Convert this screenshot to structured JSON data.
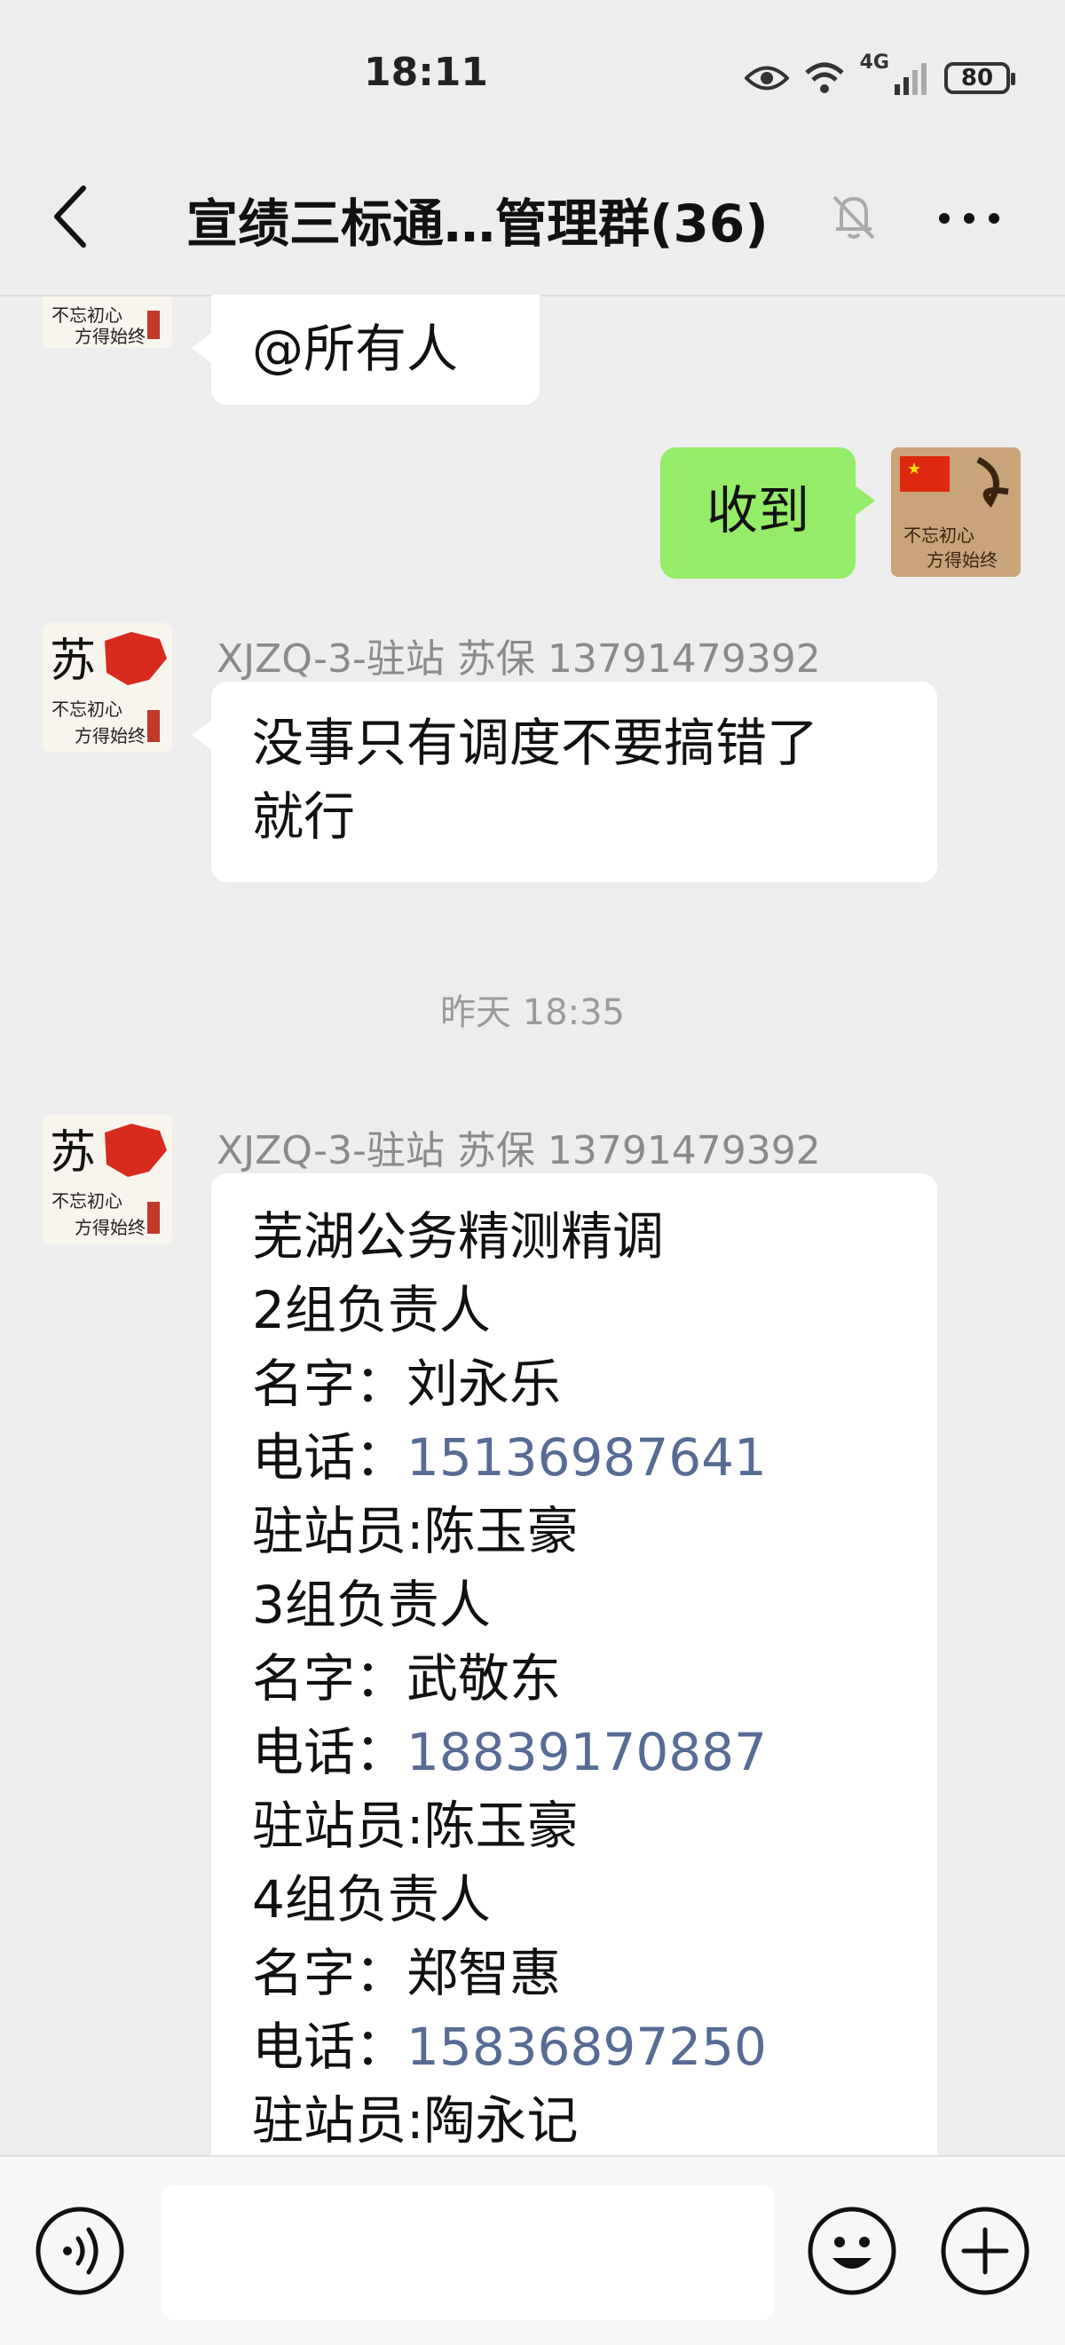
{
  "status_bar": {
    "time": "18:11",
    "battery": "80",
    "network": "4G"
  },
  "header": {
    "title": "宣绩三标通…管理群(36)"
  },
  "messages": {
    "m1": {
      "text": "@所有人"
    },
    "m2": {
      "text": "收到"
    },
    "m3": {
      "sender": "XJZQ-3-驻站  苏保 13791479392",
      "lines": [
        "没事只有调度不要搞错了",
        "就行"
      ]
    },
    "timestamp": "昨天 18:35",
    "m4": {
      "sender": "XJZQ-3-驻站  苏保 13791479392",
      "lines": [
        "芜湖公务精测精调",
        "2组负责人",
        "名字：刘永乐",
        "电话：",
        "15136987641",
        "驻站员:陈玉豪",
        "3组负责人",
        "名字：武敬东",
        "电话：",
        "18839170887",
        "驻站员:陈玉豪",
        "4组负责人",
        "名字：郑智惠",
        "电话：",
        "15836897250",
        "驻站员:陶永记"
      ]
    }
  },
  "avatar": {
    "caption_1": "不忘初心",
    "caption_2": "方得始终",
    "char": "苏"
  },
  "colors": {
    "self_bubble": "#95ec69",
    "link": "#576b95",
    "background": "#ededed"
  }
}
